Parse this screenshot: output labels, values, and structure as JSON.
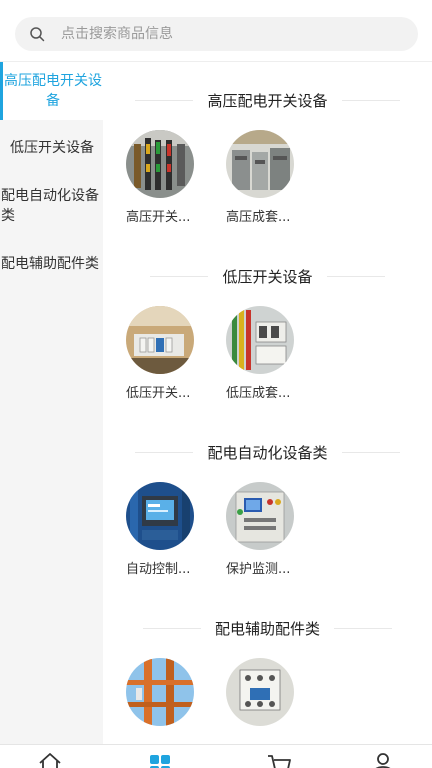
{
  "search": {
    "placeholder": "点击搜索商品信息"
  },
  "sidebar": {
    "items": [
      {
        "label": "高压配电开关设备",
        "active": true
      },
      {
        "label": "低压开关设备"
      },
      {
        "label": "配电自动化设备类"
      },
      {
        "label": "配电辅助配件类"
      }
    ]
  },
  "sections": [
    {
      "title": "高压配电开关设备",
      "products": [
        {
          "name": "高压开关..."
        },
        {
          "name": "高压成套..."
        }
      ]
    },
    {
      "title": "低压开关设备",
      "products": [
        {
          "name": "低压开关..."
        },
        {
          "name": "低压成套..."
        }
      ]
    },
    {
      "title": "配电自动化设备类",
      "products": [
        {
          "name": "自动控制..."
        },
        {
          "name": "保护监测..."
        }
      ]
    },
    {
      "title": "配电辅助配件类",
      "products": [
        {
          "name": ""
        },
        {
          "name": ""
        }
      ]
    }
  ],
  "tabbar": {
    "icons": [
      "home-icon",
      "category-icon",
      "cart-icon",
      "user-icon"
    ],
    "active_color": "#1fa4df"
  },
  "colors": {
    "accent": "#1fa4df",
    "sidebar_bg": "#f5f5f5",
    "search_bg": "#f2f2f2"
  }
}
